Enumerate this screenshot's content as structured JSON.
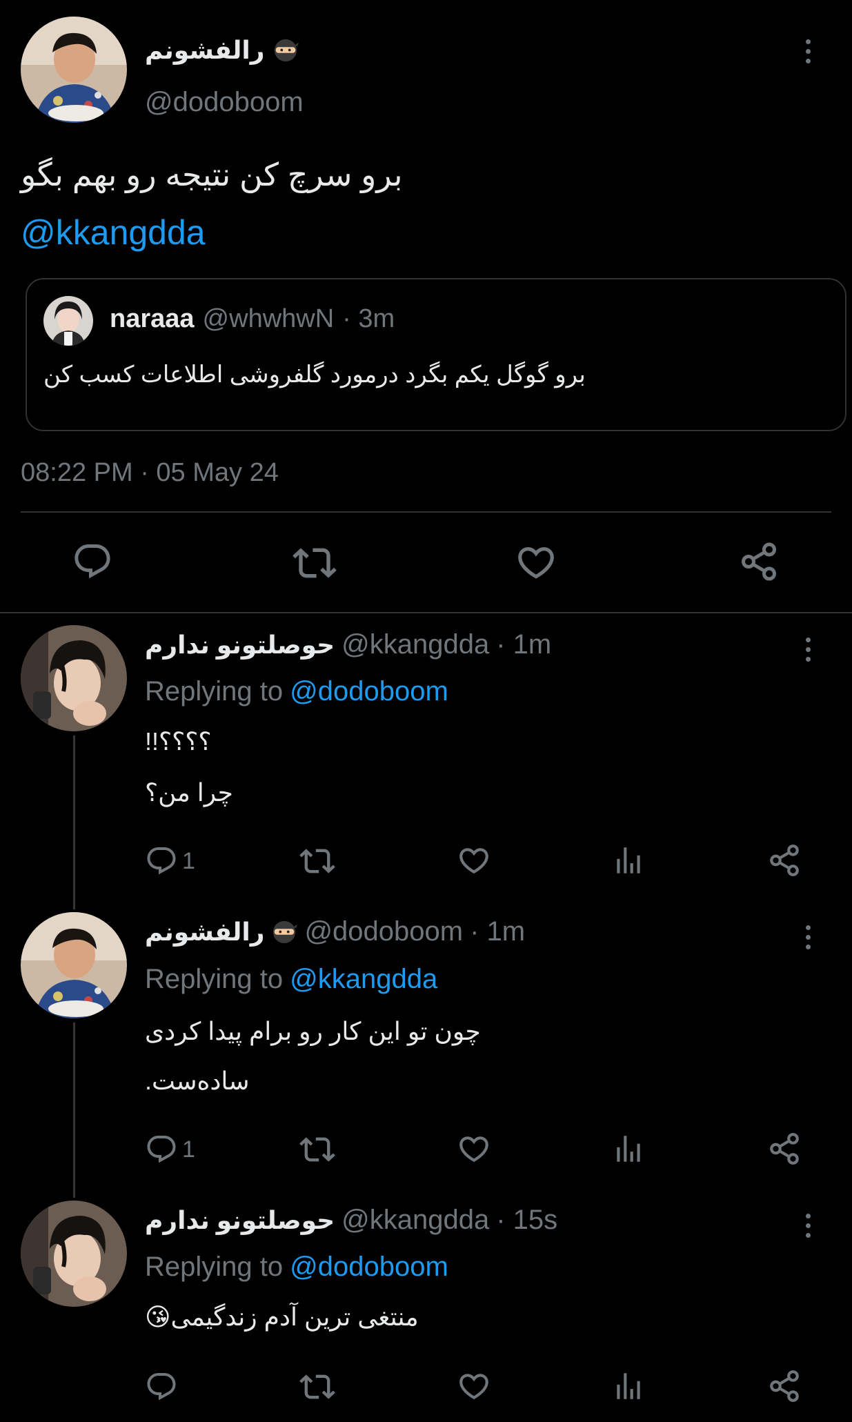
{
  "main_tweet": {
    "display_name": "رالفشونم",
    "handle": "@dodoboom",
    "text": "برو سرچ کن نتیجه رو بهم بگو",
    "mention": "@kkangdda",
    "timestamp": "08:22 PM · 05 May 24",
    "quoted": {
      "display_name": "naraaa",
      "handle": "@whwhwN",
      "time": "· 3m",
      "text": "برو گوگل یکم بگرد درمورد گلفروشی اطلاعات کسب کن"
    }
  },
  "replies": [
    {
      "display_name": "حوصلتونو ندارم",
      "handle": "@kkangdda",
      "time": "· 1m",
      "replying_label": "Replying to",
      "replying_to": "@dodoboom",
      "lines": [
        "؟؟؟؟!!",
        "چرا من؟"
      ],
      "reply_count": "1"
    },
    {
      "display_name": "رالفشونم",
      "handle": "@dodoboom",
      "time": "· 1m",
      "replying_label": "Replying to",
      "replying_to": "@kkangdda",
      "lines": [
        "چون تو این کار رو برام پیدا کردی",
        "ساده‌ست."
      ],
      "reply_count": "1"
    },
    {
      "display_name": "حوصلتونو ندارم",
      "handle": "@kkangdda",
      "time": "· 15s",
      "replying_label": "Replying to",
      "replying_to": "@dodoboom",
      "lines": [
        "منتغی ترین آدم زندگیمی😘"
      ],
      "reply_count": ""
    }
  ],
  "icons": {
    "more": "more-vertical-icon",
    "reply": "reply-icon",
    "retweet": "retweet-icon",
    "like": "heart-icon",
    "views": "views-icon",
    "share": "share-icon",
    "ninja": "ninja-emoji"
  },
  "colors": {
    "background": "#000000",
    "text": "#e7e9ea",
    "muted": "#71767b",
    "accent": "#1d9bf0",
    "divider": "#2f3336"
  }
}
